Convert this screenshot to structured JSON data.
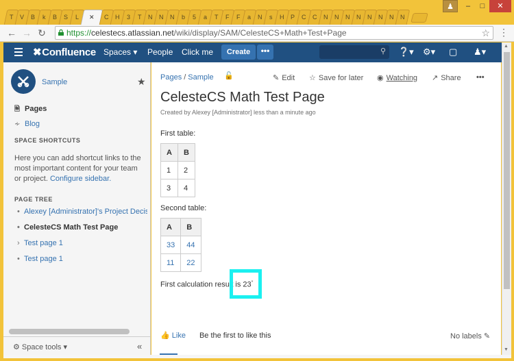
{
  "browser": {
    "tabs": [
      {
        "label": "T"
      },
      {
        "label": "V"
      },
      {
        "label": "B"
      },
      {
        "label": "k"
      },
      {
        "label": "B"
      },
      {
        "label": "S"
      },
      {
        "label": "L"
      },
      {
        "label": "✕",
        "active": true
      },
      {
        "label": "C"
      },
      {
        "label": "H"
      },
      {
        "label": "3"
      },
      {
        "label": "T"
      },
      {
        "label": "N"
      },
      {
        "label": "N"
      },
      {
        "label": "N"
      },
      {
        "label": "b"
      },
      {
        "label": "5"
      },
      {
        "label": "a"
      },
      {
        "label": "T"
      },
      {
        "label": "F"
      },
      {
        "label": "F"
      },
      {
        "label": "a"
      },
      {
        "label": "N"
      },
      {
        "label": "s"
      },
      {
        "label": "H"
      },
      {
        "label": "P"
      },
      {
        "label": "C"
      },
      {
        "label": "C"
      },
      {
        "label": "N"
      },
      {
        "label": "N"
      },
      {
        "label": "N"
      },
      {
        "label": "N"
      },
      {
        "label": "N"
      },
      {
        "label": "N"
      },
      {
        "label": "N"
      },
      {
        "label": "N"
      }
    ],
    "url_scheme": "https://",
    "url_host": "celestecs.atlassian.net",
    "url_path": "/wiki/display/SAM/CelesteCS+Math+Test+Page",
    "window_user_icon": "user-icon",
    "minimize": "–",
    "close": "✕"
  },
  "header": {
    "logo": "Confluence",
    "nav": {
      "spaces": "Spaces ▾",
      "people": "People",
      "click_me": "Click me"
    },
    "create": "Create",
    "more": "•••",
    "colors": {
      "bar": "#205081",
      "button": "#3572b0"
    }
  },
  "sidebar": {
    "space_name": "Sample",
    "pages": "Pages",
    "blog": "Blog",
    "shortcuts_heading": "SPACE SHORTCUTS",
    "shortcuts_text": "Here you can add shortcut links to the most important content for your team or project.",
    "configure_link": "Configure sidebar.",
    "tree_heading": "PAGE TREE",
    "tree": [
      {
        "label": "Alexey [Administrator]'s Project Decisio",
        "bullet": "•"
      },
      {
        "label": "CelesteCS Math Test Page",
        "bullet": "•",
        "current": true
      },
      {
        "label": "Test page 1",
        "bullet": "›"
      },
      {
        "label": "Test page 1",
        "bullet": "•"
      }
    ],
    "space_tools": "Space tools ▾",
    "collapse": "«"
  },
  "page": {
    "breadcrumb": [
      "Pages",
      "Sample"
    ],
    "actions": {
      "edit": "Edit",
      "save_later": "Save for later",
      "watching": "Watching",
      "share": "Share",
      "more": "•••"
    },
    "title": "CelesteCS Math Test Page",
    "byline": "Created by Alexey [Administrator] less than a minute ago",
    "first_table_label": "First table:",
    "table1": {
      "headers": [
        "A",
        "B"
      ],
      "rows": [
        [
          "1",
          "2"
        ],
        [
          "3",
          "4"
        ]
      ]
    },
    "second_table_label": "Second table:",
    "table2": {
      "headers": [
        "A",
        "B"
      ],
      "rows": [
        [
          "33",
          "44"
        ],
        [
          "11",
          "22"
        ]
      ]
    },
    "calc_text": "First calculation result is 23",
    "calc_sup": "*",
    "like": "Like",
    "first_to_like": "Be the first to like this",
    "no_labels": "No labels",
    "highlight_color": "#1bf0f0"
  }
}
